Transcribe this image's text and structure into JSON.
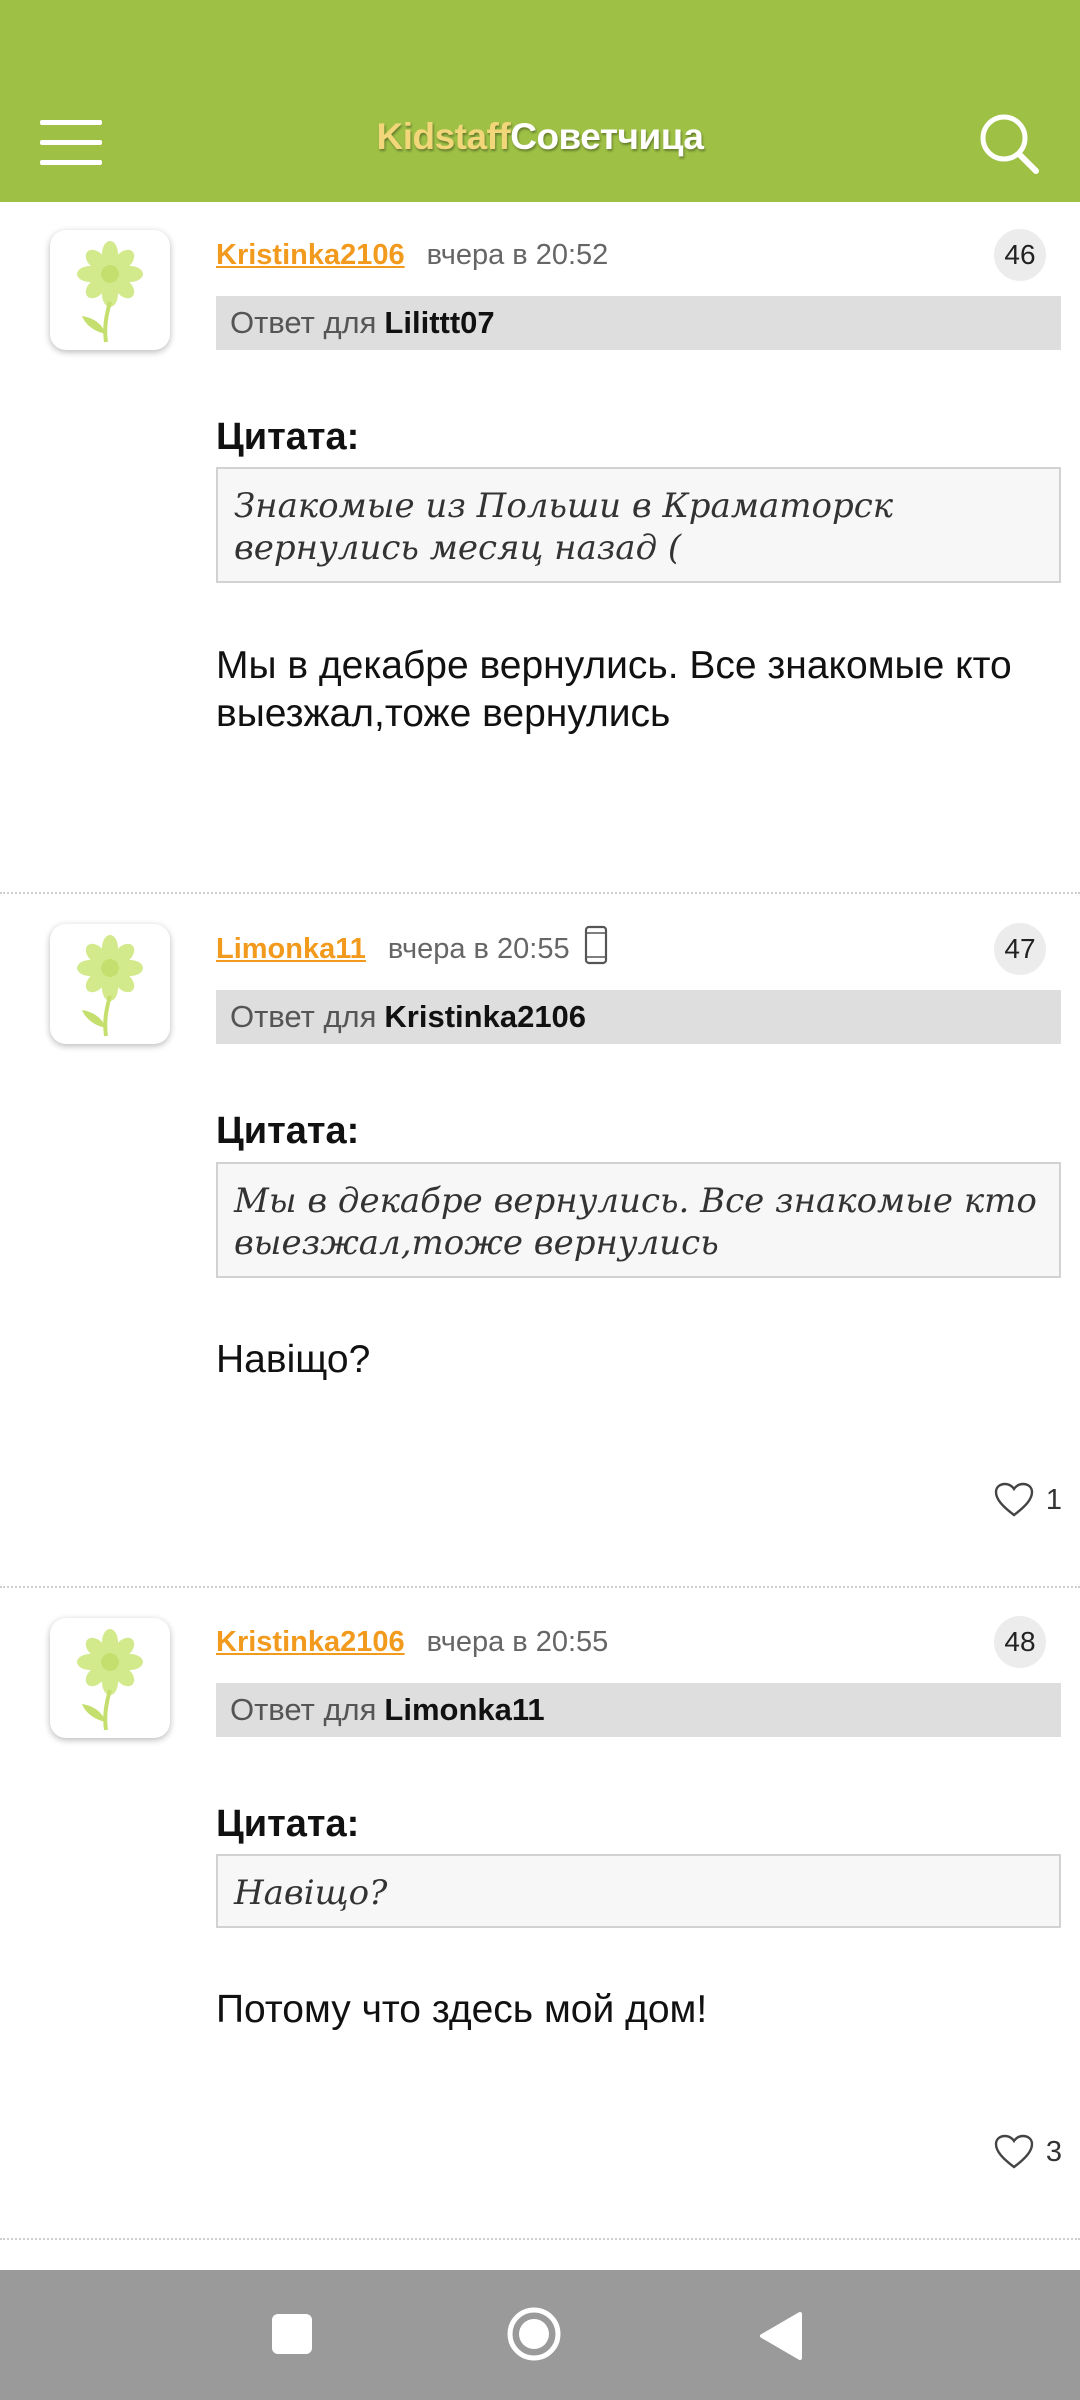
{
  "header": {
    "logo_part1": "Kidstaff",
    "logo_part2": "Советчица",
    "menu_icon": "hamburger-menu-icon",
    "search_icon": "search-icon",
    "background_color": "#9dc045"
  },
  "posts": [
    {
      "author": "Kristinka2106",
      "time": "вчера в 20:52",
      "number": "46",
      "reply_label": "Ответ для",
      "reply_to": "Lilittt07",
      "quote_label": "Цитата:",
      "quote": "Знакомые из Польши в Краматорск вернулись месяц назад (",
      "text": "Мы в декабре вернулись. Все знакомые кто выезжал,тоже вернулись"
    },
    {
      "author": "Limonka11",
      "time": "вчера в 20:55",
      "device_icon": "mobile-phone-icon",
      "number": "47",
      "reply_label": "Ответ для",
      "reply_to": "Kristinka2106",
      "quote_label": "Цитата:",
      "quote": "Мы в декабре вернулись. Все знакомые кто выезжал,тоже вернулись",
      "text": "Навіщо?",
      "likes": "1"
    },
    {
      "author": "Kristinka2106",
      "time": "вчера в 20:55",
      "number": "48",
      "reply_label": "Ответ для",
      "reply_to": "Limonka11",
      "quote_label": "Цитата:",
      "quote": "Навіщо?",
      "text": "Потому что здесь мой дом!",
      "likes": "3"
    }
  ],
  "colors": {
    "author": "#f29a1d",
    "accent_green": "#9dc045",
    "navbar": "#9a9a9a"
  }
}
